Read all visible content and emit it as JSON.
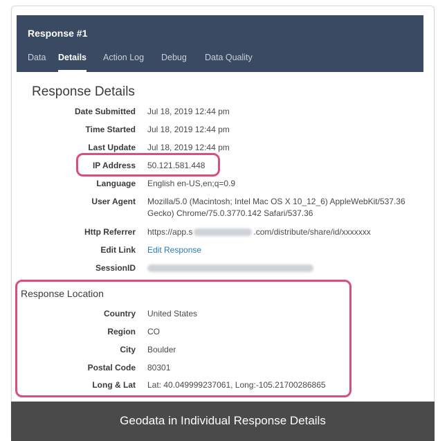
{
  "response": {
    "title": "Response #1",
    "tabs": [
      "Data",
      "Details",
      "Action Log",
      "Debug",
      "Data Quality"
    ],
    "active_tab": "Details"
  },
  "details": {
    "section_title": "Response Details",
    "rows": [
      {
        "label": "Date Submitted",
        "value": "Jul 18, 2019 12:44 pm"
      },
      {
        "label": "Time Started",
        "value": "Jul 18, 2019 12:44 pm"
      },
      {
        "label": "Last Update",
        "value": "Jul 18, 2019 12:44 pm"
      },
      {
        "label": "IP Address",
        "value": "50.121.581.448"
      },
      {
        "label": "Language",
        "value": "English en-US,en;q=0.9"
      },
      {
        "label": "User Agent",
        "value": "Mozilla/5.0 (Macintosh; Intel Mac OS X 10_12_6) AppleWebKit/537.36",
        "value2": "Gecko) Chrome/75.0.3770.142 Safari/537.36"
      },
      {
        "label": "Http Referrer",
        "value_prefix": "https://app.s",
        "value_suffix": ".com/distribute/share/id/xxxxxxx"
      },
      {
        "label": "Edit Link",
        "value": "Edit Response"
      },
      {
        "label": "SessionID",
        "value": ""
      }
    ]
  },
  "location": {
    "section_title": "Response Location",
    "rows": [
      {
        "label": "Country",
        "value": "United States"
      },
      {
        "label": "Region",
        "value": "CO"
      },
      {
        "label": "City",
        "value": "Boulder"
      },
      {
        "label": "Postal Code",
        "value": "80301"
      },
      {
        "label": "Long & Lat",
        "value": "Lat: 40.049999237061, Long:-105.21700286865"
      }
    ]
  },
  "caption": "Geodata in Individual Response Details",
  "colors": {
    "header_bg": "#3b4a63",
    "highlight": "#d94e7c",
    "link": "#2a7ab8",
    "caption_bg": "#4a4a4a"
  }
}
